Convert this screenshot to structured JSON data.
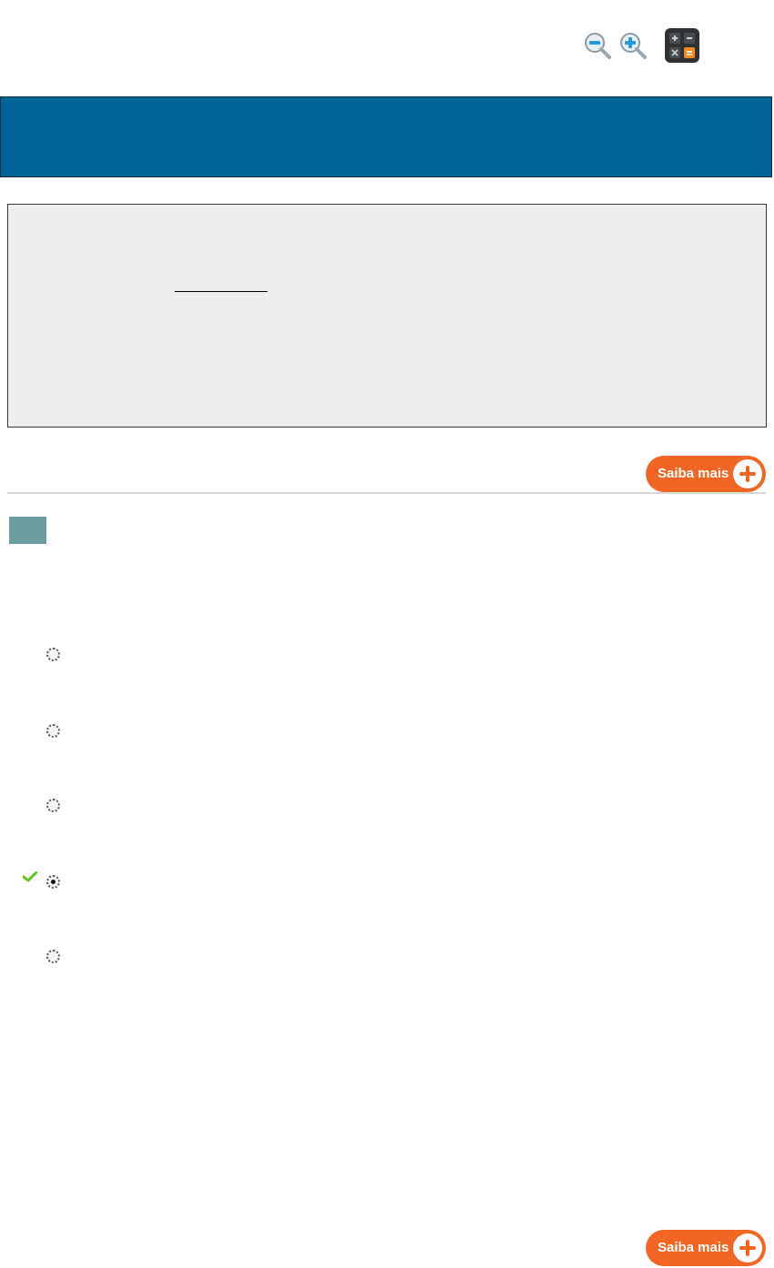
{
  "toolbar": {
    "icons": [
      "zoom-out-icon",
      "zoom-in-icon",
      "calculator-icon"
    ]
  },
  "buttons": {
    "saiba_mais_label": "Saiba mais"
  },
  "question": {
    "options": [
      {
        "selected": false,
        "correct": false
      },
      {
        "selected": false,
        "correct": false
      },
      {
        "selected": false,
        "correct": false
      },
      {
        "selected": true,
        "correct": true
      },
      {
        "selected": false,
        "correct": false
      }
    ]
  },
  "colors": {
    "banner": "#006699",
    "statement_bg": "#eeeeee",
    "saiba_mais": "#f26522",
    "question_number_bg": "#6b9ea0",
    "check": "#5cc21e"
  }
}
